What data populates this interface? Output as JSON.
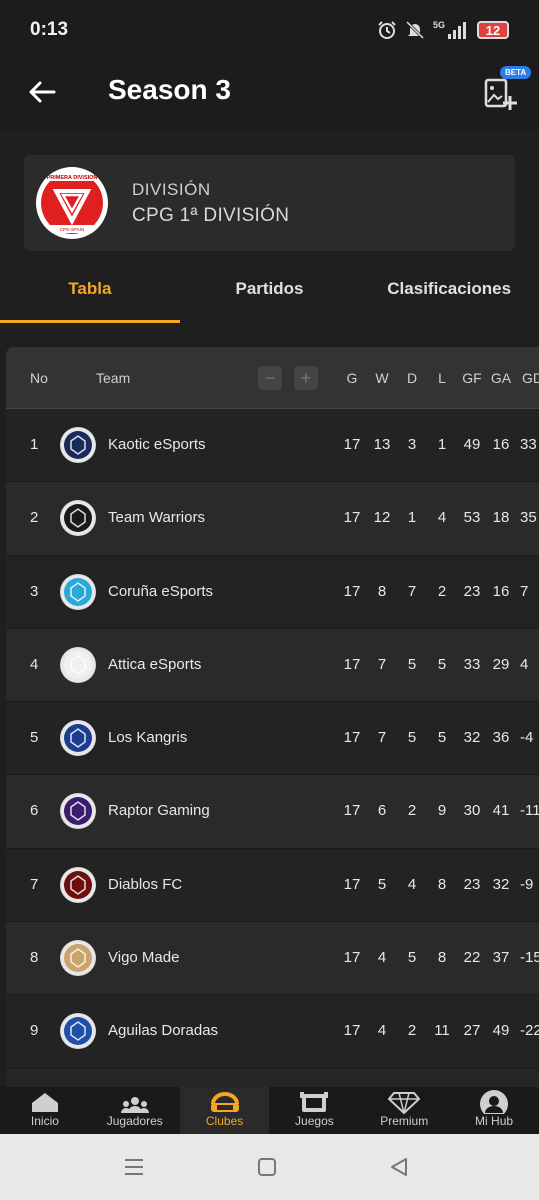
{
  "status_bar": {
    "time": "0:13",
    "network": "5G",
    "battery": "12"
  },
  "app_bar": {
    "title": "Season 3",
    "beta": "BETA"
  },
  "division": {
    "label": "DIVISIÓN",
    "name": "CPG 1ª DIVISIÓN",
    "logo_text": "PRIMERA DIVISION",
    "logo_subtext": "CPG-SPAIN"
  },
  "tabs": [
    {
      "label": "Tabla",
      "active": true
    },
    {
      "label": "Partidos",
      "active": false
    },
    {
      "label": "Clasificaciones",
      "active": false
    }
  ],
  "table": {
    "headers": {
      "no": "No",
      "team": "Team",
      "g": "G",
      "w": "W",
      "d": "D",
      "l": "L",
      "gf": "GF",
      "ga": "GA",
      "gd": "GD"
    },
    "zoom_minus": "−",
    "zoom_plus": "+",
    "rows": [
      {
        "no": "1",
        "team": "Kaotic eSports",
        "g": "17",
        "w": "13",
        "d": "3",
        "l": "1",
        "gf": "49",
        "ga": "16",
        "gd": "33",
        "crest_color": "#1a2a5a"
      },
      {
        "no": "2",
        "team": "Team Warriors",
        "g": "17",
        "w": "12",
        "d": "1",
        "l": "4",
        "gf": "53",
        "ga": "18",
        "gd": "35",
        "crest_color": "#1a1a1a"
      },
      {
        "no": "3",
        "team": "Coruña eSports",
        "g": "17",
        "w": "8",
        "d": "7",
        "l": "2",
        "gf": "23",
        "ga": "16",
        "gd": "7",
        "crest_color": "#2aa8d8"
      },
      {
        "no": "4",
        "team": "Attica eSports",
        "g": "17",
        "w": "7",
        "d": "5",
        "l": "5",
        "gf": "33",
        "ga": "29",
        "gd": "4",
        "crest_color": "#f0f0f0"
      },
      {
        "no": "5",
        "team": "Los Kangris",
        "g": "17",
        "w": "7",
        "d": "5",
        "l": "5",
        "gf": "32",
        "ga": "36",
        "gd": "-4",
        "crest_color": "#1b3d8f"
      },
      {
        "no": "6",
        "team": "Raptor Gaming",
        "g": "17",
        "w": "6",
        "d": "2",
        "l": "9",
        "gf": "30",
        "ga": "41",
        "gd": "-11",
        "crest_color": "#3a1d6e"
      },
      {
        "no": "7",
        "team": "Diablos FC",
        "g": "17",
        "w": "5",
        "d": "4",
        "l": "8",
        "gf": "23",
        "ga": "32",
        "gd": "-9",
        "crest_color": "#6e0f0f"
      },
      {
        "no": "8",
        "team": "Vigo Made",
        "g": "17",
        "w": "4",
        "d": "5",
        "l": "8",
        "gf": "22",
        "ga": "37",
        "gd": "-15",
        "crest_color": "#c9a56a"
      },
      {
        "no": "9",
        "team": "Aguilas Doradas",
        "g": "17",
        "w": "4",
        "d": "2",
        "l": "11",
        "gf": "27",
        "ga": "49",
        "gd": "-22",
        "crest_color": "#1f4fa8"
      }
    ]
  },
  "bottom_nav": [
    {
      "label": "Inicio",
      "icon": "home-icon",
      "active": false
    },
    {
      "label": "Jugadores",
      "icon": "players-icon",
      "active": false
    },
    {
      "label": "Clubes",
      "icon": "clubs-icon",
      "active": true
    },
    {
      "label": "Juegos",
      "icon": "games-icon",
      "active": false
    },
    {
      "label": "Premium",
      "icon": "diamond-icon",
      "active": false
    },
    {
      "label": "Mi Hub",
      "icon": "profile-icon",
      "active": false
    }
  ],
  "colors": {
    "accent": "#f5a623",
    "background": "#1f1f1f",
    "card": "#2b2b2b"
  }
}
